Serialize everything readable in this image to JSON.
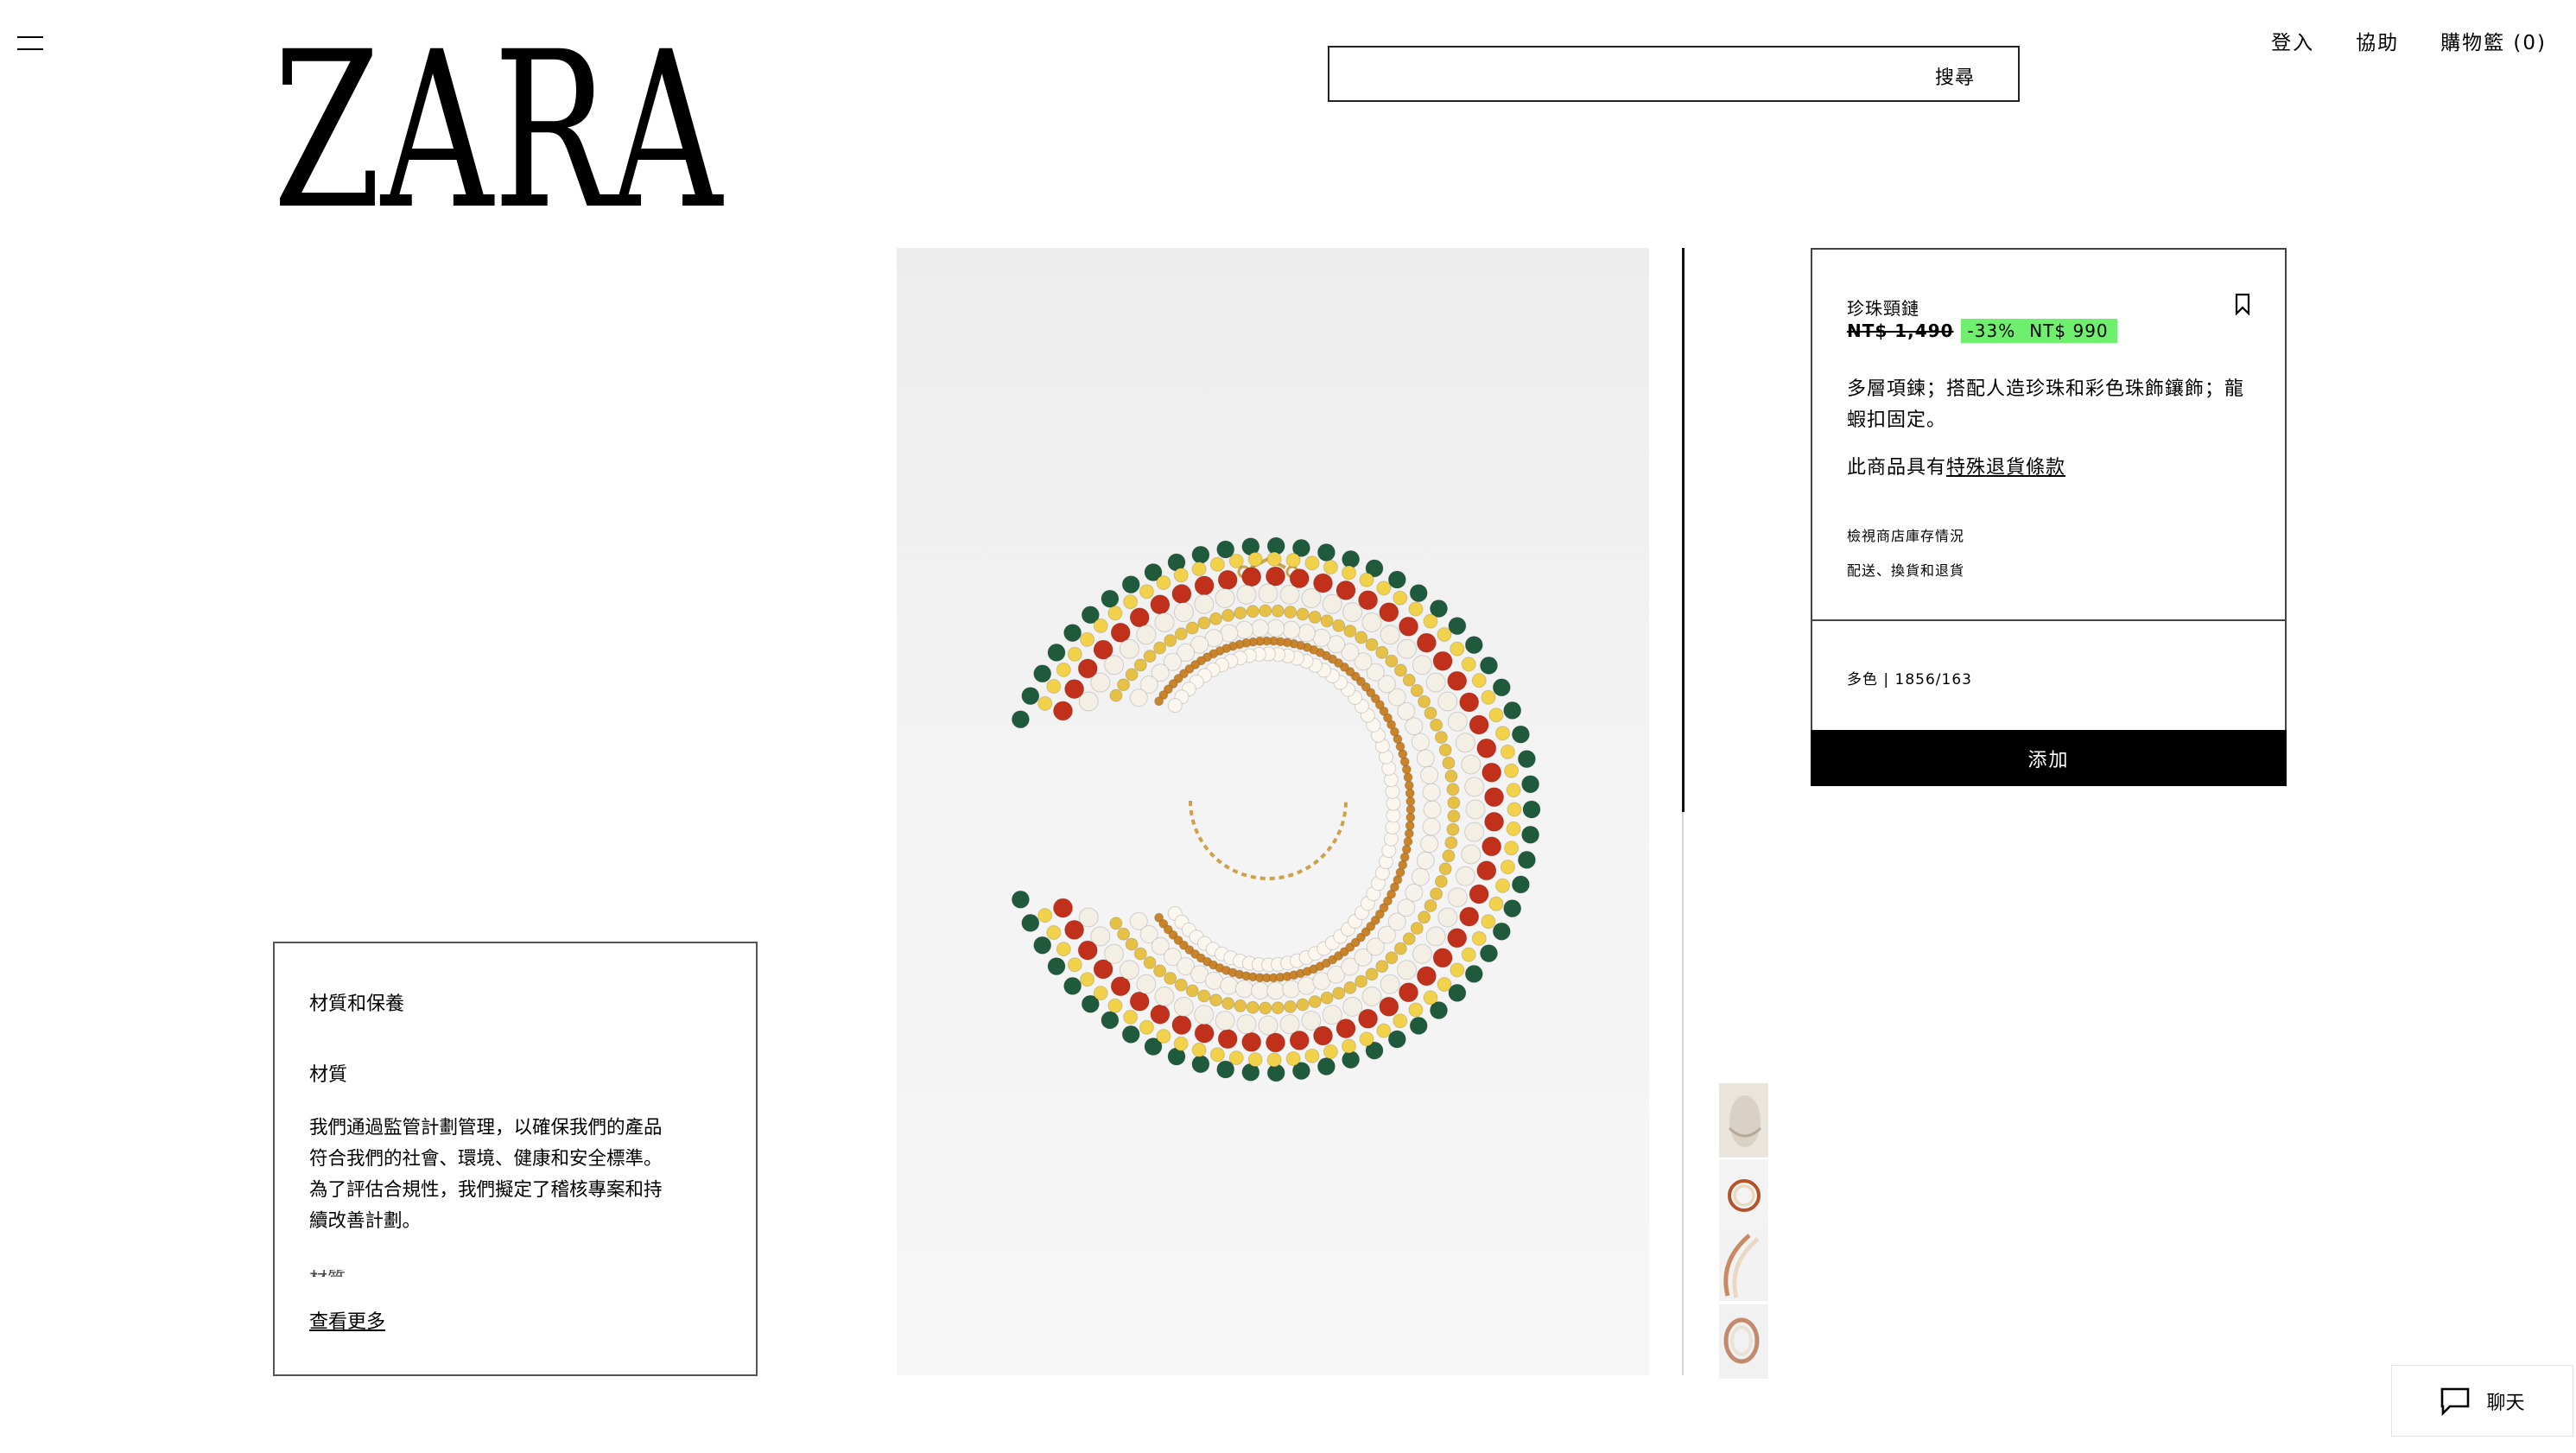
{
  "header": {
    "logo_text": "ZARA",
    "search": {
      "label": "搜尋",
      "value": ""
    },
    "nav": {
      "login": "登入",
      "help": "協助",
      "cart": "購物籃 (0)"
    }
  },
  "care_panel": {
    "title": "材質和保養",
    "section": "材質",
    "text": "我們通過監管計劃管理，以確保我們的產品符合我們的社會、環境、健康和安全標準。為了評估合規性，我們擬定了稽核專案和持續改善計劃。",
    "truncated_next": "材質",
    "see_more": "查看更多"
  },
  "product": {
    "name": "珍珠頸鏈",
    "old_price": "NT$ 1,490",
    "discount": "-33%",
    "new_price": "NT$ 990",
    "description": "多層項鍊；搭配人造珍珠和彩色珠飾鑲飾；龍蝦扣固定。",
    "return_prefix": "此商品具有",
    "return_link": "特殊退貨條款",
    "store_stock": "檢視商店庫存情況",
    "shipping": "配送、換貨和退貨",
    "color_label": "多色",
    "ref": "| 1856/163",
    "add_label": "添加"
  },
  "chat": {
    "label": "聊天"
  },
  "icons": {
    "menu": "hamburger-icon",
    "bookmark": "bookmark-icon",
    "chat": "chat-bubble-icon"
  },
  "colors": {
    "discount_highlight": "#6ef06e",
    "add_button_bg": "#000000",
    "text": "#000000"
  }
}
